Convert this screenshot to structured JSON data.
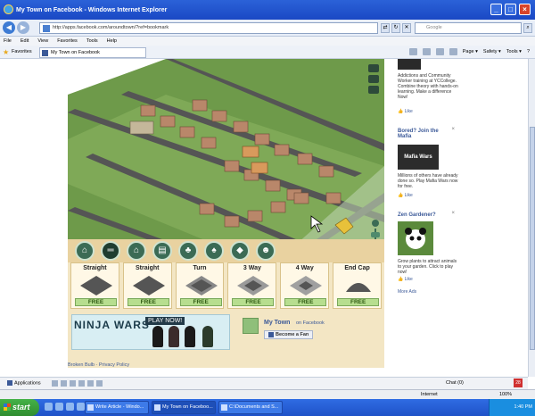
{
  "window": {
    "title": "My Town on Facebook - Windows Internet Explorer",
    "min": "_",
    "max": "□",
    "close": "×"
  },
  "address": {
    "url": "http://apps.facebook.com/aroundtown/?ref=bookmark",
    "search_placeholder": "Google"
  },
  "menu": [
    "File",
    "Edit",
    "View",
    "Favorites",
    "Tools",
    "Help"
  ],
  "favorites": {
    "label": "Favorites",
    "tab_title": "My Town on Facebook"
  },
  "toolbar": [
    "Page ▾",
    "Safety ▾",
    "Tools ▾",
    "?"
  ],
  "palette_icons": [
    "building-icon",
    "road-icon",
    "house-icon",
    "shop-icon",
    "tree-icon",
    "park-icon",
    "decor-icon",
    "people-icon"
  ],
  "tiles": [
    {
      "name": "Straight",
      "price": "FREE"
    },
    {
      "name": "Straight",
      "price": "FREE"
    },
    {
      "name": "Turn",
      "price": "FREE"
    },
    {
      "name": "3 Way",
      "price": "FREE"
    },
    {
      "name": "4 Way",
      "price": "FREE"
    },
    {
      "name": "End Cap",
      "price": "FREE"
    }
  ],
  "banner": {
    "title": "NINJA WARS",
    "play": "PLAY NOW!"
  },
  "fanbox": {
    "name": "My Town",
    "on": "on Facebook",
    "button": "Become a Fan"
  },
  "footer": {
    "left": "Broken Bulb",
    "sep": " - ",
    "right": "Privacy Policy"
  },
  "ads": [
    {
      "title": "",
      "body": "Addictions and Community Worker training at YCCollege. Combine theory with hands-on learning. Make a difference Now!",
      "like": "Like"
    },
    {
      "title": "Bored? Join the Mafia",
      "image_text": "Mafia Wars",
      "body": "Millions of others have already done so. Play Mafia Wars now for free.",
      "like": "Like"
    },
    {
      "title": "Zen Gardener?",
      "body": "Grow plants to attract animals to your garden. Click to play now!",
      "like": "Like"
    }
  ],
  "more_ads": "More Ads",
  "fbbar": {
    "apps": "Applications",
    "chat": "Chat (0)",
    "badge": "28"
  },
  "status": {
    "zone": "Internet",
    "zoom": "100%"
  },
  "taskbar": {
    "start": "start",
    "tasks": [
      "Write Article - Windo...",
      "My Town on Faceboo...",
      "C:\\Documents and S..."
    ],
    "time": "1:40 PM"
  }
}
